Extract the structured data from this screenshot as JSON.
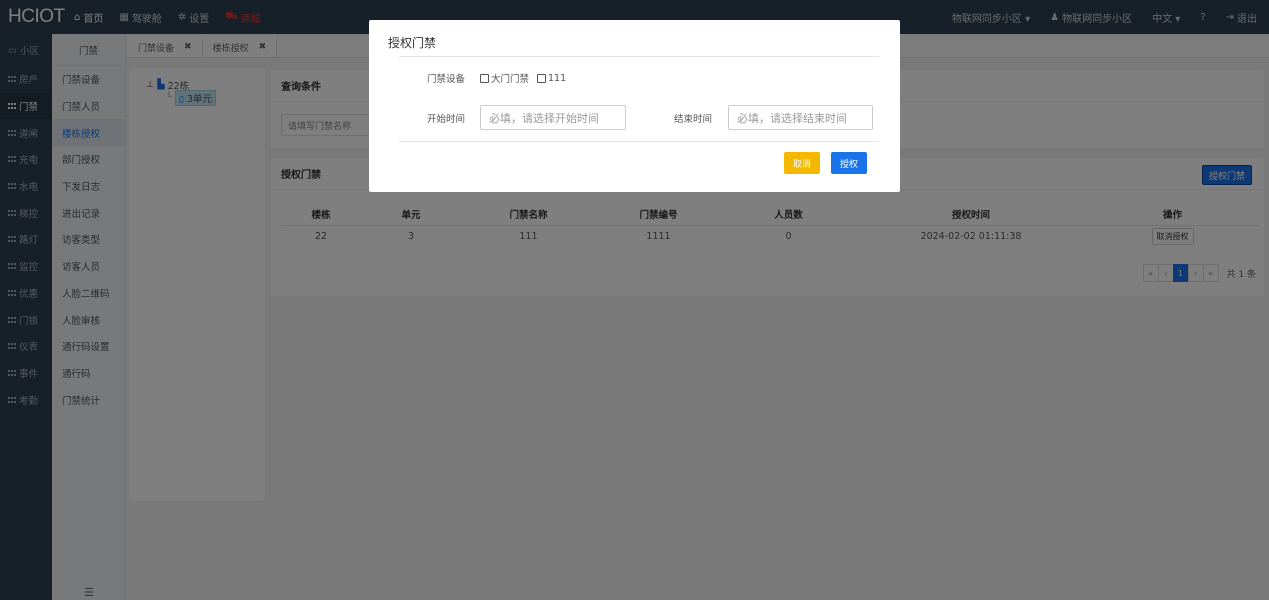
{
  "app": {
    "logo": "HCIOT"
  },
  "topnav": [
    {
      "icon": "home-icon",
      "label": "首页",
      "glyph": "⌂"
    },
    {
      "icon": "dashboard-icon",
      "label": "驾驶舱",
      "glyph": "▦"
    },
    {
      "icon": "gear-icon",
      "label": "设置",
      "glyph": "✲"
    },
    {
      "icon": "cart-icon",
      "label": "商城",
      "glyph": "⛟"
    }
  ],
  "topright": {
    "community": "物联网同步小区 ▾",
    "user": "物联网同步小区",
    "language": "中文 ▾",
    "help": "?",
    "logout": "退出"
  },
  "leftnav": [
    "小区",
    "房产",
    "门禁",
    "道闸",
    "充电",
    "水电",
    "梯控",
    "路灯",
    "监控",
    "优惠",
    "门锁",
    "仪表",
    "事件",
    "考勤"
  ],
  "subnav": {
    "head": "门禁",
    "items": [
      "门禁设备",
      "门禁人员",
      "楼栋授权",
      "部门授权",
      "下发日志",
      "进出记录",
      "访客类型",
      "访客人员",
      "人脸二维码",
      "人脸审核",
      "通行码设置",
      "通行码",
      "门禁统计"
    ],
    "collapse_glyph": "☰"
  },
  "tabs": [
    {
      "label": "门禁设备",
      "close": "✖"
    },
    {
      "label": "楼栋授权",
      "close": "✖"
    }
  ],
  "tree": {
    "root": "22栋",
    "child": "3单元"
  },
  "query": {
    "title": "查询条件",
    "placeholder": "请填写门禁名称"
  },
  "list": {
    "title": "授权门禁",
    "auth_button": "授权门禁",
    "columns": [
      "楼栋",
      "单元",
      "门禁名称",
      "门禁编号",
      "人员数",
      "授权时间",
      "操作"
    ],
    "rows": [
      {
        "building": "22",
        "unit": "3",
        "name": "111",
        "code": "1111",
        "count": "0",
        "time": "2024-02-02 01:11:38",
        "action": "取消授权"
      }
    ],
    "pager": {
      "first": "«",
      "prev": "‹",
      "current": "1",
      "next": "›",
      "last": "»",
      "total": "共 1 条"
    }
  },
  "modal": {
    "title": "授权门禁",
    "device_label": "门禁设备",
    "devices": [
      "大门门禁",
      "111"
    ],
    "start_label": "开始时间",
    "start_placeholder": "必填，请选择开始时间",
    "end_label": "结束时间",
    "end_placeholder": "必填，请选择结束时间",
    "cancel": "取消",
    "ok": "授权"
  },
  "colors": {
    "accent": "#1a73e8",
    "warn": "#f5b800",
    "nav_bg": "#2f4050"
  }
}
